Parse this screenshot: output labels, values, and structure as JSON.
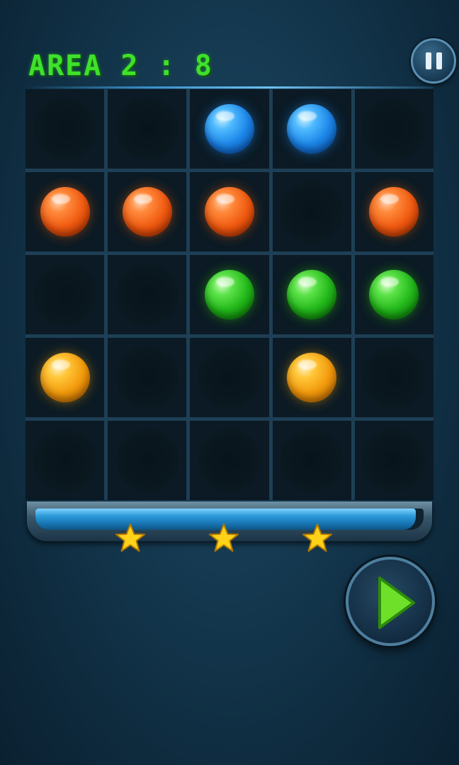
{
  "header": {
    "area_title": "AREA 2 : 8",
    "pause_icon": "pause-icon"
  },
  "board": {
    "rows": 5,
    "columns": 5,
    "cells": [
      [
        "empty",
        "empty",
        "blue",
        "blue",
        "empty"
      ],
      [
        "orange",
        "orange",
        "orange",
        "empty",
        "orange"
      ],
      [
        "empty",
        "empty",
        "green",
        "green",
        "green"
      ],
      [
        "yellow",
        "empty",
        "empty",
        "yellow",
        "empty"
      ],
      [
        "empty",
        "empty",
        "empty",
        "empty",
        "empty"
      ]
    ]
  },
  "progress": {
    "fill_fraction": 0.98,
    "stars_earned": 3,
    "stars_total": 3,
    "star_icon": "star-icon"
  },
  "controls": {
    "play_icon": "play-icon"
  },
  "colors": {
    "title_green": "#3fe22a",
    "blue_ball": "#1c86e8",
    "orange_ball": "#f05a10",
    "green_ball": "#22b81a",
    "yellow_ball": "#f29a0c",
    "star_gold": "#ffd21a",
    "play_green": "#6ee02a"
  }
}
